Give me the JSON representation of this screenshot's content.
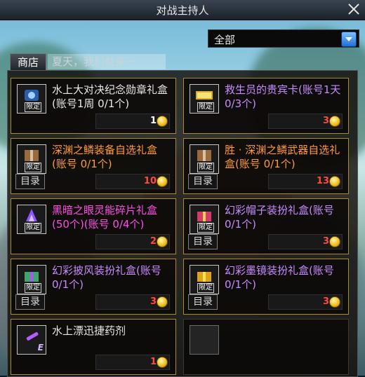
{
  "window": {
    "title": "对战主持人",
    "close_icon": "close-icon"
  },
  "filter": {
    "selected": "全部"
  },
  "tab": {
    "label": "商店"
  },
  "ticker": {
    "text": "夏天，我们就来一"
  },
  "badges": {
    "limited": "限定",
    "e": "E"
  },
  "catalog_label": "目录",
  "items": [
    {
      "name": "水上大对决纪念勋章礼盒(账号1周 0/1个)",
      "color": "white",
      "price": "1",
      "price_color": "white",
      "catalog": false,
      "badge": "limited"
    },
    {
      "name": "救生员的贵宾卡(账号1天 0/3个)",
      "color": "purple",
      "price": "3",
      "price_color": "red",
      "catalog": false,
      "badge": "limited"
    },
    {
      "name": "深渊之鳞装备自选礼盒(账号 0/1个)",
      "color": "orange",
      "price": "10",
      "price_color": "red",
      "catalog": true,
      "badge": "limited"
    },
    {
      "name": "胜 · 深渊之鳞武器自选礼盒(账号 0/1个)",
      "color": "orange",
      "price": "13",
      "price_color": "red",
      "catalog": true,
      "badge": "limited"
    },
    {
      "name": "黑暗之眼灵能碎片礼盒(50个)(账号 0/4个)",
      "color": "magenta",
      "price": "2",
      "price_color": "red",
      "catalog": false,
      "badge": "limited"
    },
    {
      "name": "幻彩帽子装扮礼盒(账号 0/1个)",
      "color": "purple",
      "price": "3",
      "price_color": "red",
      "catalog": true,
      "badge": "limited"
    },
    {
      "name": "幻彩披风装扮礼盒(账号 0/1个)",
      "color": "purple",
      "price": "3",
      "price_color": "red",
      "catalog": true,
      "badge": "limited"
    },
    {
      "name": "幻彩墨镜装扮礼盒(账号 0/1个)",
      "color": "purple",
      "price": "3",
      "price_color": "red",
      "catalog": true,
      "badge": "limited"
    },
    {
      "name": "水上漂迅捷药剂",
      "color": "white",
      "price": "1",
      "price_color": "red",
      "catalog": false,
      "badge": "e"
    }
  ],
  "colors": {
    "card_border": "#a98b36",
    "orange": "#ff9a3a",
    "magenta": "#ff4fe6",
    "purple": "#c78bff",
    "red": "#ff4a3a"
  }
}
